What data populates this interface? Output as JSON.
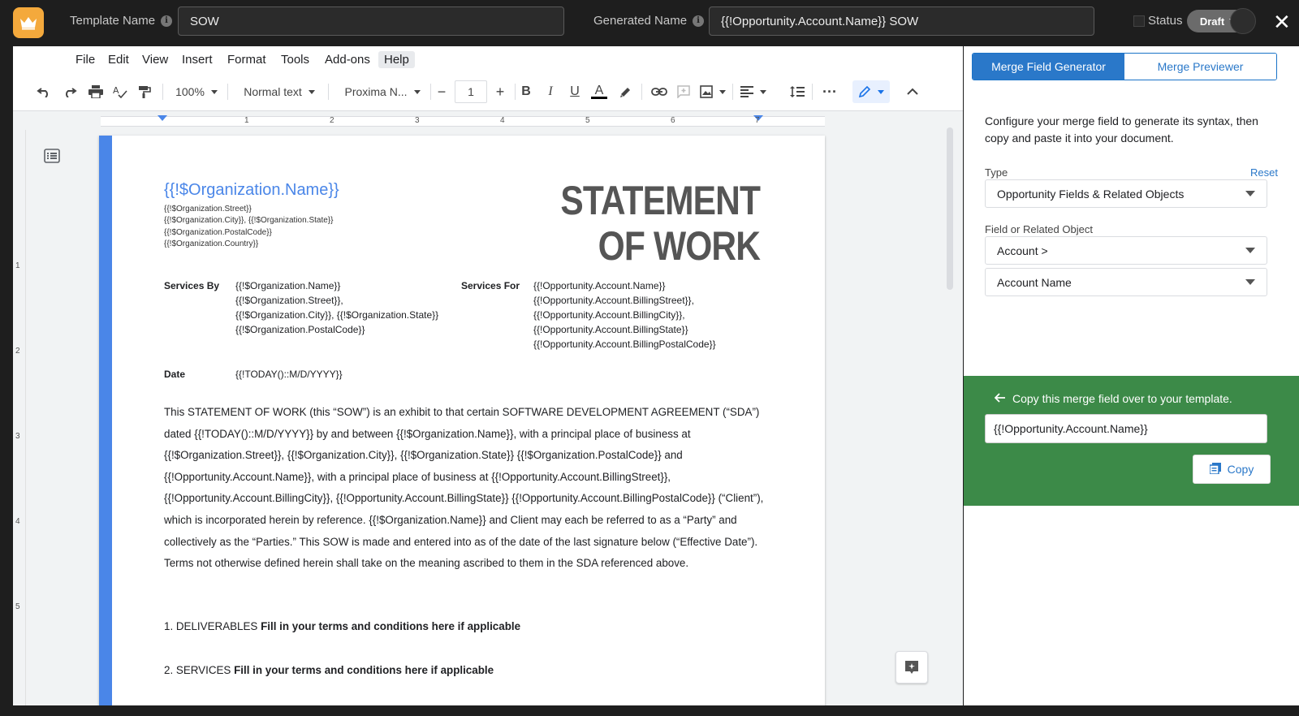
{
  "header": {
    "template_name_label": "Template Name",
    "template_name_value": "SOW",
    "generated_name_label": "Generated Name",
    "generated_name_value": "{{!Opportunity.Account.Name}} SOW",
    "status_label": "Status",
    "status_value": "Draft"
  },
  "docs": {
    "menu": [
      "File",
      "Edit",
      "View",
      "Insert",
      "Format",
      "Tools",
      "Add-ons",
      "Help"
    ],
    "toolbar": {
      "zoom": "100%",
      "style": "Normal text",
      "font": "Proxima N...",
      "font_size": "1"
    },
    "ruler_numbers": [
      "1",
      "2",
      "3",
      "4",
      "5",
      "6",
      "7"
    ]
  },
  "document": {
    "org_name": "{{!$Organization.Name}}",
    "org_street": "{{!$Organization.Street}}",
    "org_city_state": "{{!$Organization.City}}, {{!$Organization.State}}",
    "org_postal": "{{!$Organization.PostalCode}}",
    "org_country": "{{!$Organization.Country}}",
    "title_line1": "STATEMENT",
    "title_line2": "OF WORK",
    "services_by_label": "Services By",
    "services_by": [
      "{{!$Organization.Name}}",
      "{{!$Organization.Street}},",
      "{{!$Organization.City}}, {{!$Organization.State}}",
      "{{!$Organization.PostalCode}}"
    ],
    "services_for_label": "Services For",
    "services_for": [
      "{{!Opportunity.Account.Name}}",
      "{{!Opportunity.Account.BillingStreet}},",
      "{{!Opportunity.Account.BillingCity}},",
      "{{!Opportunity.Account.BillingState}}",
      "{{!Opportunity.Account.BillingPostalCode}}"
    ],
    "date_label": "Date",
    "date_value": "{{!TODAY()::M/D/YYYY}}",
    "body_paragraph": "This STATEMENT OF WORK (this “SOW”) is an exhibit to that certain SOFTWARE DEVELOPMENT AGREEMENT (“SDA”) dated {{!TODAY()::M/D/YYYY}} by and between {{!$Organization.Name}}, with a principal place of business at {{!$Organization.Street}}, {{!$Organization.City}}, {{!$Organization.State}} {{!$Organization.PostalCode}} and {{!Opportunity.Account.Name}}, with a principal place of business at {{!Opportunity.Account.BillingStreet}}, {{!Opportunity.Account.BillingCity}}, {{!Opportunity.Account.BillingState}} {{!Opportunity.Account.BillingPostalCode}} (“Client”), which is incorporated herein by reference. {{!$Organization.Name}} and Client may each be referred to as a “Party” and collectively as the “Parties.” This SOW is made and entered into as of the date of the last signature below (“Effective Date”). Terms not otherwise defined herein shall take on the meaning ascribed to them in the SDA referenced above.",
    "section1_label": "1. DELIVERABLES",
    "section1_hint": "Fill in your terms and conditions here if applicable",
    "section2_label": "2. SERVICES",
    "section2_hint": "Fill in your terms and conditions here if applicable"
  },
  "sidebar": {
    "tab_generator": "Merge Field Generator",
    "tab_previewer": "Merge Previewer",
    "intro": "Configure your merge field to generate its syntax, then copy and paste it into your document.",
    "type_label": "Type",
    "reset_label": "Reset",
    "type_value": "Opportunity Fields & Related Objects",
    "field_label": "Field or Related Object",
    "field_value": "Account >",
    "subfield_value": "Account Name",
    "copy_header": "Copy this merge field over to your template.",
    "merge_field": "{{!Opportunity.Account.Name}}",
    "copy_button": "Copy"
  },
  "colors": {
    "accent_blue": "#2a78c9",
    "copy_panel_green": "#3c8a48",
    "doc_margin_blue": "#4a86e8",
    "logo_orange": "#f4a93c"
  }
}
